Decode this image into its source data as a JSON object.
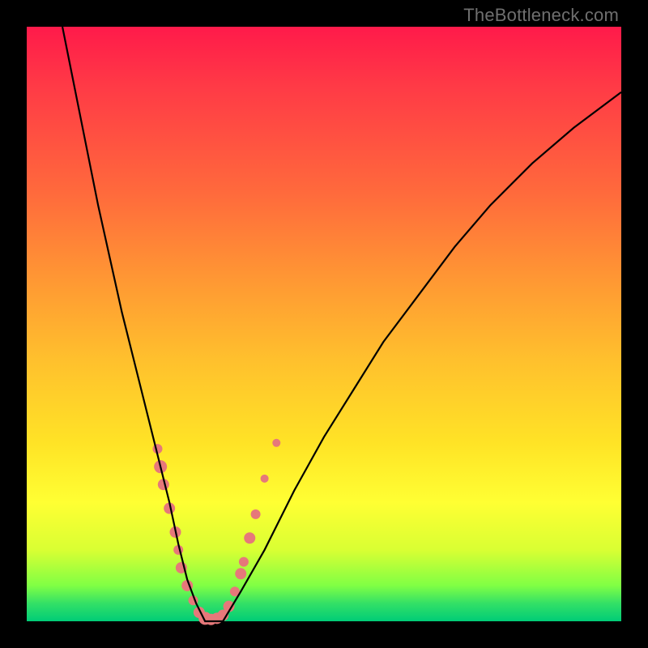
{
  "watermark": "TheBottleneck.com",
  "chart_data": {
    "type": "line",
    "title": "",
    "xlabel": "",
    "ylabel": "",
    "xlim": [
      0,
      100
    ],
    "ylim": [
      0,
      100
    ],
    "series": [
      {
        "name": "curve",
        "x": [
          6,
          8,
          10,
          12,
          14,
          16,
          18,
          20,
          22,
          24,
          25.5,
          27,
          28.5,
          30,
          33,
          36,
          40,
          45,
          50,
          55,
          60,
          66,
          72,
          78,
          85,
          92,
          100
        ],
        "y": [
          100,
          90,
          80,
          70,
          61,
          52,
          44,
          36,
          28,
          20,
          13,
          7,
          3,
          0,
          0,
          5,
          12,
          22,
          31,
          39,
          47,
          55,
          63,
          70,
          77,
          83,
          89
        ],
        "color": "#000000"
      }
    ],
    "markers": {
      "comment": "scatter dots clustered near the valley of the curve",
      "color": "#e6787a",
      "points": [
        {
          "x": 22.0,
          "y": 29.0,
          "r": 6
        },
        {
          "x": 22.5,
          "y": 26.0,
          "r": 8
        },
        {
          "x": 23.0,
          "y": 23.0,
          "r": 7
        },
        {
          "x": 24.0,
          "y": 19.0,
          "r": 7
        },
        {
          "x": 25.0,
          "y": 15.0,
          "r": 7
        },
        {
          "x": 25.5,
          "y": 12.0,
          "r": 6
        },
        {
          "x": 26.0,
          "y": 9.0,
          "r": 7
        },
        {
          "x": 27.0,
          "y": 6.0,
          "r": 7
        },
        {
          "x": 28.0,
          "y": 3.5,
          "r": 6
        },
        {
          "x": 29.0,
          "y": 1.5,
          "r": 7
        },
        {
          "x": 30.0,
          "y": 0.5,
          "r": 8
        },
        {
          "x": 31.0,
          "y": 0.3,
          "r": 7
        },
        {
          "x": 32.0,
          "y": 0.5,
          "r": 7
        },
        {
          "x": 33.0,
          "y": 1.0,
          "r": 7
        },
        {
          "x": 34.0,
          "y": 2.5,
          "r": 7
        },
        {
          "x": 35.0,
          "y": 5.0,
          "r": 6
        },
        {
          "x": 36.0,
          "y": 8.0,
          "r": 7
        },
        {
          "x": 36.5,
          "y": 10.0,
          "r": 6
        },
        {
          "x": 37.5,
          "y": 14.0,
          "r": 7
        },
        {
          "x": 38.5,
          "y": 18.0,
          "r": 6
        },
        {
          "x": 40.0,
          "y": 24.0,
          "r": 5
        },
        {
          "x": 42.0,
          "y": 30.0,
          "r": 5
        }
      ]
    },
    "background_gradient": {
      "top": "#ff1a4a",
      "mid_upper": "#ff9933",
      "mid": "#ffe326",
      "mid_lower": "#ffff33",
      "bottom": "#00cc77"
    }
  }
}
